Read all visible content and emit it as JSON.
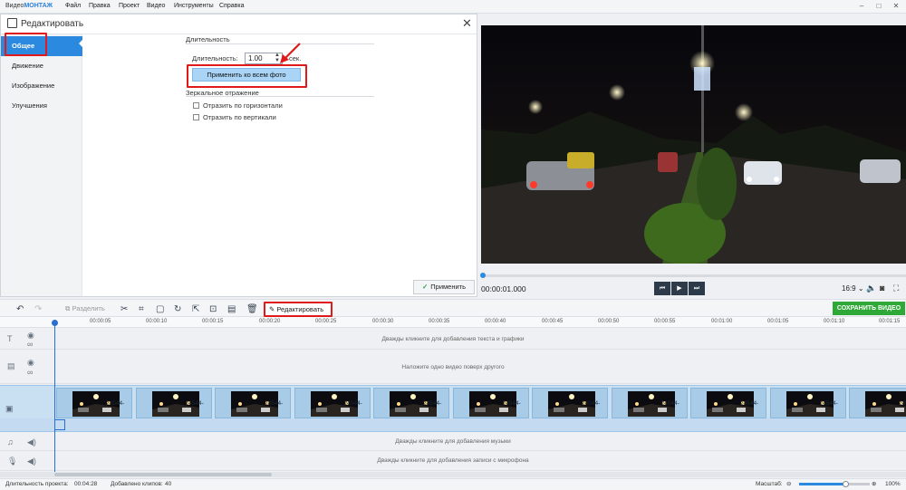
{
  "app": {
    "logo_prefix": "Видео",
    "logo_suffix": "МОНТАЖ",
    "menu": [
      "Файл",
      "Правка",
      "Проект",
      "Видео",
      "Инструменты",
      "Справка"
    ],
    "window_controls": [
      "–",
      "□",
      "✕"
    ]
  },
  "edit_panel": {
    "title": "Редактировать",
    "close": "✕",
    "sidebar": [
      "Общее",
      "Движение",
      "Изображение",
      "Улучшения"
    ],
    "duration_section": "Длительность",
    "duration_label": "Длительность:",
    "duration_value": "1.00",
    "duration_unit": "сек.",
    "apply_all_label": "Применить ко всем фото",
    "mirror_section": "Зеркальное отражение",
    "mirror_h": "Отразить по горизонтали",
    "mirror_v": "Отразить по вертикали",
    "apply_label": "Применить"
  },
  "player": {
    "timecode": "00:00:01.000",
    "aspect_ratio": "16:9",
    "buttons": [
      "prev",
      "play",
      "next"
    ]
  },
  "toolbar": {
    "split_label": "Разделить",
    "edit_label": "Редактировать",
    "save_label": "СОХРАНИТЬ ВИДЕО"
  },
  "timeline": {
    "ticks": [
      "00:00:05",
      "00:00:10",
      "00:00:15",
      "00:00:20",
      "00:00:25",
      "00:00:30",
      "00:00:35",
      "00:00:40",
      "00:00:45",
      "00:00:50",
      "00:00:55",
      "00:01:00",
      "00:01:05",
      "00:01:10",
      "00:01:15"
    ],
    "text_hint": "Дважды кликните для добавления текста и графики",
    "overlay_hint": "Наложите одно видео поверх другого",
    "music_hint": "Дважды кликните для добавления музыки",
    "mic_hint": "Дважды кликните для добавления записи с микрофона",
    "clips": [
      "24544-",
      "24544-",
      "24544-",
      "24544-",
      "24544-",
      "24544-",
      "24544-",
      "24544-",
      "24544-",
      "24544-",
      "24544-",
      "24544-"
    ]
  },
  "status": {
    "duration_label": "Длительность проекта:",
    "duration_value": "00:04:28",
    "clips_label": "Добавлено клипов:",
    "clips_value": "40",
    "zoom_label": "Масштаб:",
    "zoom_value": "100%"
  },
  "colors": {
    "accent": "#2b8ae0",
    "save": "#2ea836",
    "highlight": "#e01a1a"
  }
}
